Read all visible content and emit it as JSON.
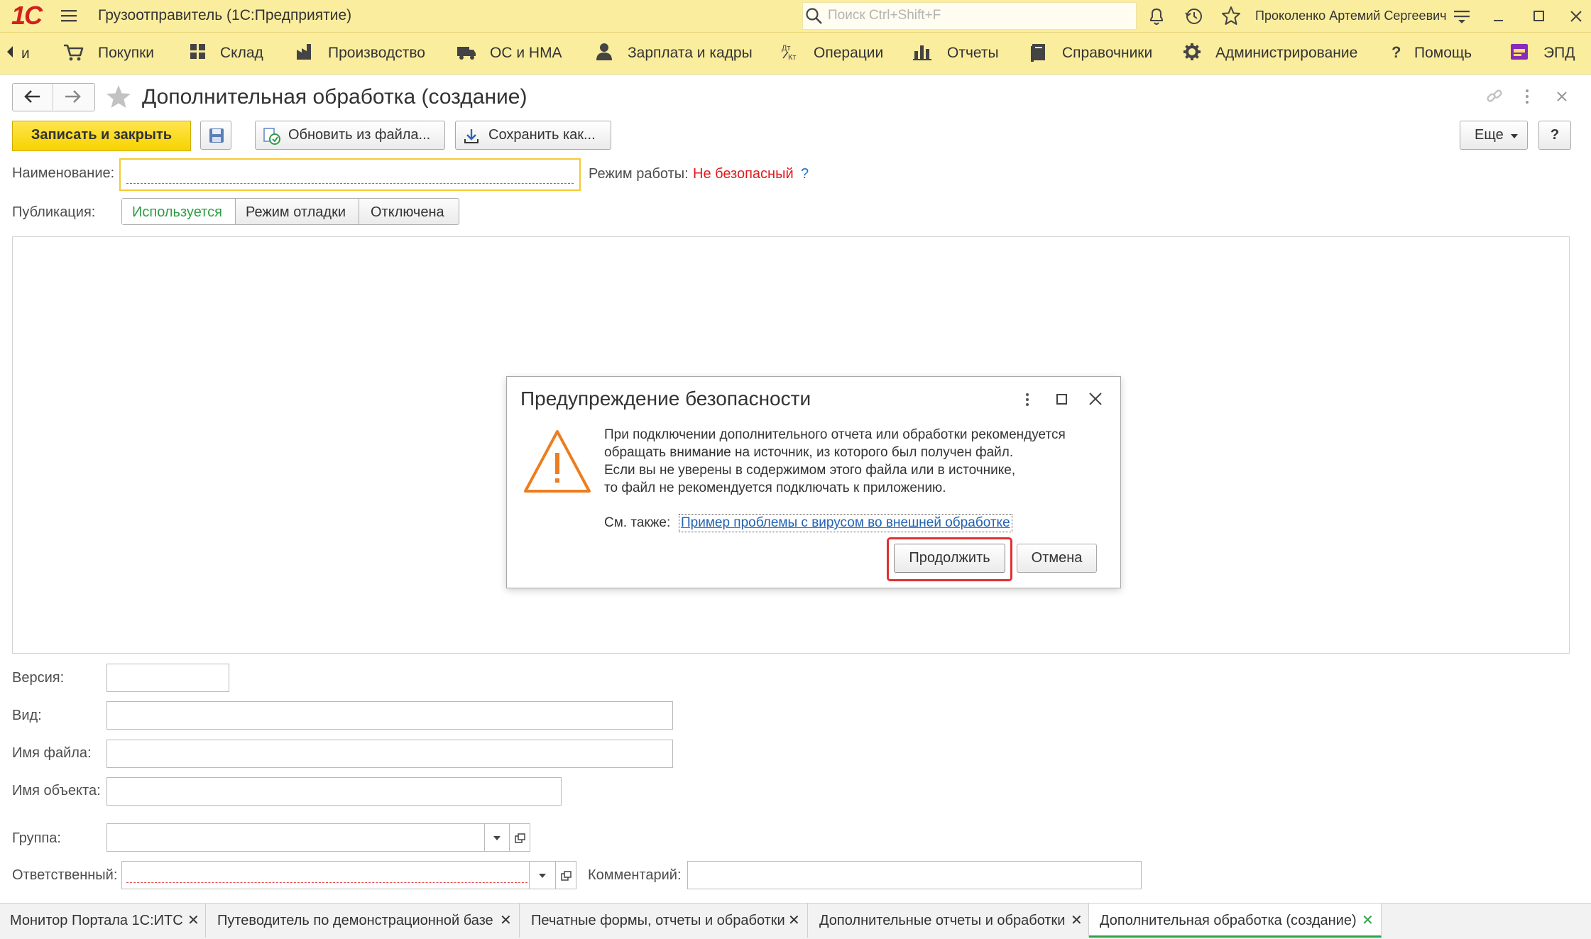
{
  "app": {
    "title": "Грузоотправитель  (1С:Предприятие)",
    "logo": "1С",
    "search_placeholder": "Поиск Ctrl+Shift+F",
    "user": "Проколенко Артемий Сергеевич",
    "accent_color": "#fbed9e"
  },
  "sections": [
    {
      "label": "Покупки",
      "icon": "cart-icon"
    },
    {
      "label": "Склад",
      "icon": "warehouse-icon"
    },
    {
      "label": "Производство",
      "icon": "factory-icon"
    },
    {
      "label": "ОС и НМА",
      "icon": "truck-icon"
    },
    {
      "label": "Зарплата и кадры",
      "icon": "person-icon"
    },
    {
      "label": "Операции",
      "icon": "operations-icon"
    },
    {
      "label": "Отчеты",
      "icon": "bar-chart-icon"
    },
    {
      "label": "Справочники",
      "icon": "book-icon"
    },
    {
      "label": "Администрирование",
      "icon": "gear-icon"
    },
    {
      "label": "Помощь",
      "icon": "question-icon"
    },
    {
      "label": "ЭПД",
      "icon": "epd-icon"
    }
  ],
  "form": {
    "title": "Дополнительная обработка (создание)",
    "toolbar": {
      "save_close": "Записать и закрыть",
      "update_from_file": "Обновить из файла...",
      "save_as": "Сохранить как...",
      "more": "Еще",
      "help": "?"
    },
    "name_label": "Наименование:",
    "name_value": "",
    "mode_label": "Режим работы:",
    "mode_value": "Не безопасный",
    "mode_help": "?",
    "publication_label": "Публикация:",
    "publication_options": [
      "Используется",
      "Режим отладки",
      "Отключена"
    ],
    "publication_selected": "Используется",
    "version_label": "Версия:",
    "kind_label": "Вид:",
    "filename_label": "Имя файла:",
    "objectname_label": "Имя объекта:",
    "group_label": "Группа:",
    "responsible_label": "Ответственный:",
    "comment_label": "Комментарий:"
  },
  "dialog": {
    "title": "Предупреждение безопасности",
    "lines": [
      "При подключении дополнительного отчета или обработки рекомендуется",
      "обращать внимание на источник, из которого был получен файл.",
      "Если вы не уверены в содержимом этого файла или в источнике,",
      "то файл не рекомендуется подключать к приложению."
    ],
    "see_also_label": "См. также:",
    "see_also_link": "Пример проблемы с вирусом во внешней обработке",
    "continue": "Продолжить",
    "cancel": "Отмена"
  },
  "tabs": [
    "Монитор Портала 1С:ИТС",
    "Путеводитель по демонстрационной базе",
    "Печатные формы, отчеты и обработки",
    "Дополнительные отчеты и обработки",
    "Дополнительная обработка (создание)"
  ],
  "active_tab": "Дополнительная обработка (создание)"
}
